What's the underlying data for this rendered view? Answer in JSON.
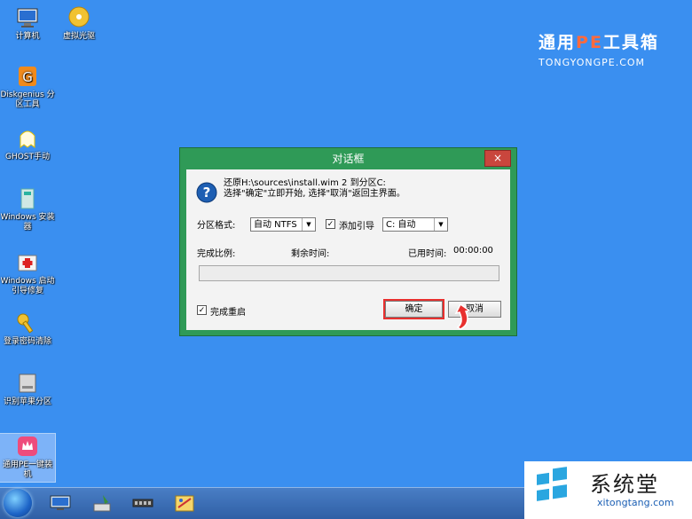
{
  "desktop_icons": [
    {
      "label": "计算机",
      "icon": "computer-icon"
    },
    {
      "label": "虚拟光驱",
      "icon": "cd-drive-icon"
    },
    {
      "label": "Diskgenius 分区工具",
      "icon": "diskgenius-icon"
    },
    {
      "label": "GHOST手动",
      "icon": "ghost-icon"
    },
    {
      "label": "Windows 安装器",
      "icon": "windows-installer-icon"
    },
    {
      "label": "Windows 启动引导修复",
      "icon": "boot-repair-icon"
    },
    {
      "label": "登录密码清除",
      "icon": "key-icon"
    },
    {
      "label": "识别苹果分区",
      "icon": "apple-partition-icon"
    },
    {
      "label": "通用PE一键装机",
      "icon": "onekey-install-icon"
    }
  ],
  "brand": {
    "left": "通用",
    "pe": "PE",
    "right": "工具箱",
    "sub": "TONGYONGPE.COM"
  },
  "dialog": {
    "title": "对话框",
    "close_label": "×",
    "message_line1": "还原H:\\sources\\install.wim 2 到分区C:",
    "message_line2": "选择\"确定\"立即开始, 选择\"取消\"返回主界面。",
    "format_label": "分区格式:",
    "format_value": "自动 NTFS",
    "add_boot_label": "添加引导",
    "add_boot_checked": "✓",
    "boot_target": "C: 自动",
    "progress_label": "完成比例:",
    "remaining_label": "剩余时间:",
    "elapsed_label": "已用时间:",
    "elapsed_value": "00:00:00",
    "progress_fraction": 0,
    "restart_label": "完成重启",
    "restart_checked": "✓",
    "ok_label": "确定",
    "cancel_label": "取消"
  },
  "watermark": {
    "name": "系统堂",
    "url": "xitongtang.com"
  },
  "colors": {
    "desktop": "#3a8ff0",
    "dialog_frame": "#2f9a57",
    "close": "#c9463d",
    "highlight": "#e8302f",
    "pe": "#ff6a3d"
  }
}
